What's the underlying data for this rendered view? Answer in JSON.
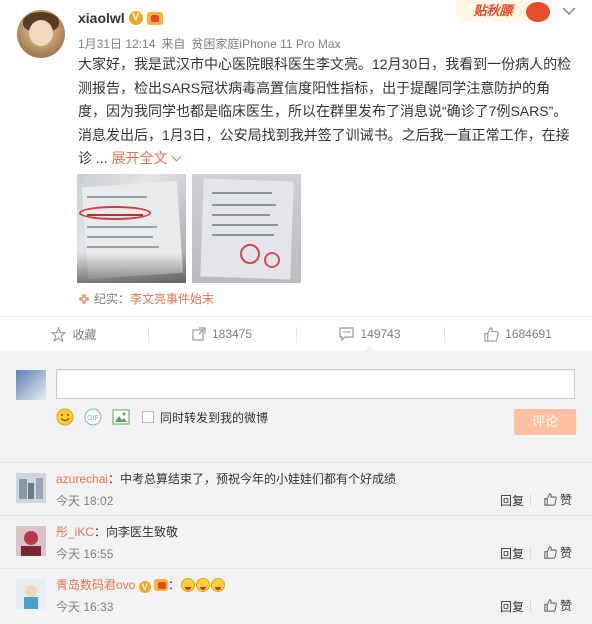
{
  "post": {
    "username": "xiaolwl",
    "meta_time": "1月31日 12:14",
    "meta_source_prefix": "来自",
    "meta_source": "贫困家庭iPhone 11 Pro Max",
    "lines": [
      "大家好，我是武汉市中心医院眼科医生李文亮。12月30日，我看到一份病人的检",
      "测报告，检出SARS冠状病毒高置信度阳性指标，出于提醒同学注意防护的角",
      "度，因为我同学也都是临床医生，所以在群里发布了消息说“确诊了7例SARS”。",
      "消息发出后，1月3日，公安局找到我并签了训诫书。之后我一直正常工作，在接",
      "诊 ..."
    ],
    "expand_label": "展开全文",
    "source_prefix": "纪实：",
    "source_link": "李文亮事件始末",
    "promo_label": "贴秋膘"
  },
  "actions": {
    "favorite": "收藏",
    "repost": "183475",
    "comment": "149743",
    "like": "1684691"
  },
  "composer": {
    "placeholder": "",
    "forward_label": "同时转发到我的微博",
    "submit_label": "评论"
  },
  "comments": [
    {
      "user": "azurechai",
      "text": "：中考总算结束了，预祝今年的小娃娃们都有个好成绩",
      "time": "今天 18:02",
      "reply": "回复",
      "like": "赞"
    },
    {
      "user": "彤_iKC",
      "text": "：向李医生致敬",
      "time": "今天 16:55",
      "reply": "回复",
      "like": "赞"
    },
    {
      "user": "青岛数码君ovo",
      "text": "：",
      "time": "今天 16:33",
      "reply": "回复",
      "like": "赞"
    }
  ],
  "colors": {
    "accent": "#eb7350",
    "submit_disabled": "#ffc09f",
    "badge": "#f5a623"
  }
}
